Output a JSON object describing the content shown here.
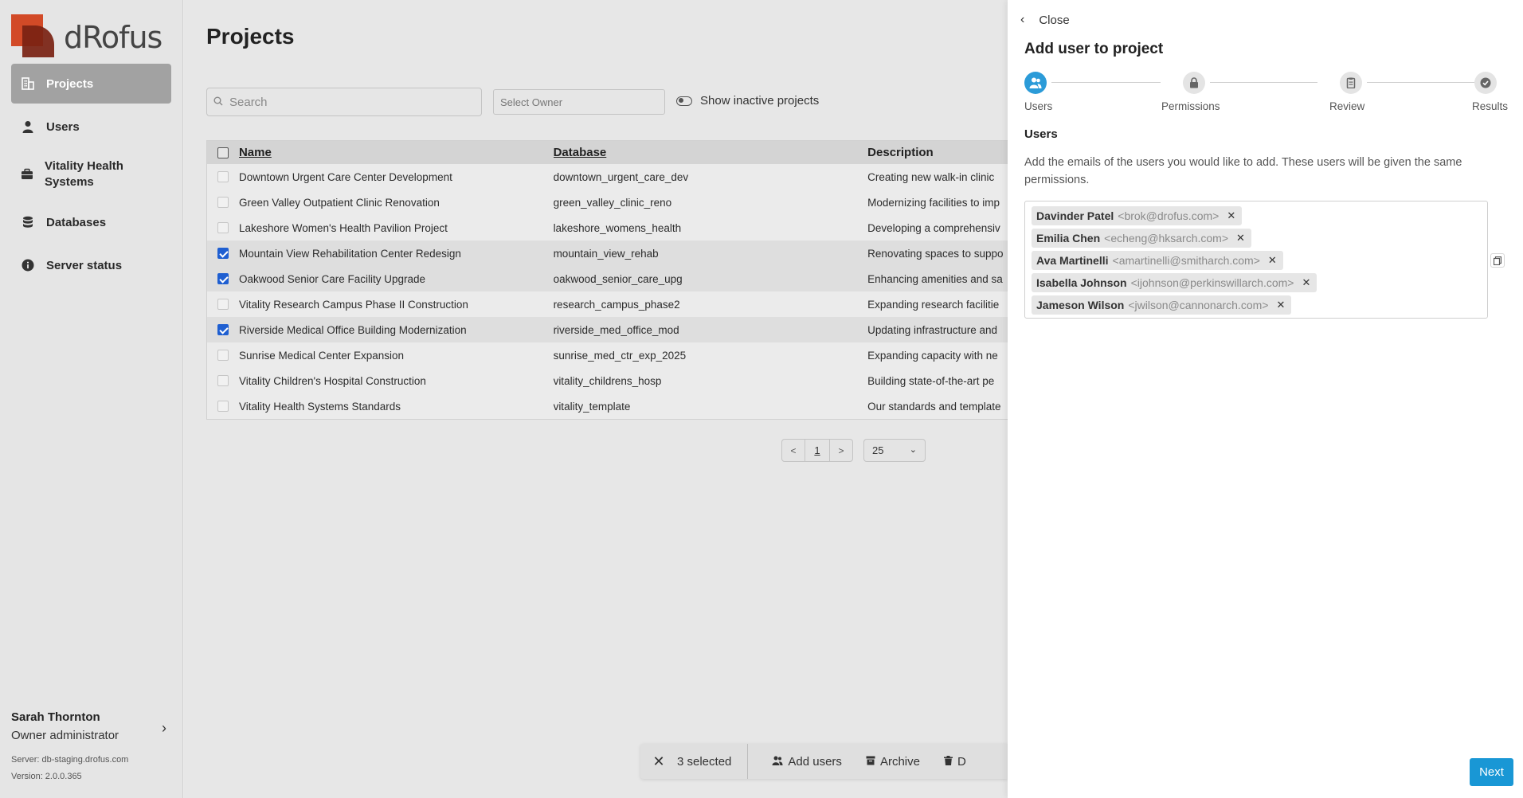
{
  "app": {
    "logo_text": "dRofus"
  },
  "sidebar": {
    "items": [
      {
        "label": "Projects",
        "icon": "building-icon"
      },
      {
        "label": "Users",
        "icon": "user-icon"
      },
      {
        "label": "Vitality Health Systems",
        "icon": "briefcase-icon"
      },
      {
        "label": "Databases",
        "icon": "database-icon"
      },
      {
        "label": "Server status",
        "icon": "info-icon"
      }
    ],
    "user": {
      "name": "Sarah Thornton",
      "role": "Owner administrator",
      "server": "Server: db-staging.drofus.com",
      "version": "Version: 2.0.0.365"
    }
  },
  "main": {
    "title": "Projects",
    "search_placeholder": "Search",
    "owner_placeholder": "Select Owner",
    "toggle_label": "Show inactive projects",
    "columns": {
      "name": "Name",
      "database": "Database",
      "description": "Description"
    },
    "rows": [
      {
        "name": "Downtown Urgent Care Center Development",
        "database": "downtown_urgent_care_dev",
        "description": "Creating new walk-in clinic",
        "selected": false
      },
      {
        "name": "Green Valley Outpatient Clinic Renovation",
        "database": "green_valley_clinic_reno",
        "description": "Modernizing facilities to imp",
        "selected": false
      },
      {
        "name": "Lakeshore Women's Health Pavilion Project",
        "database": "lakeshore_womens_health",
        "description": "Developing a comprehensiv",
        "selected": false
      },
      {
        "name": "Mountain View Rehabilitation Center Redesign",
        "database": "mountain_view_rehab",
        "description": "Renovating spaces to suppo",
        "selected": true
      },
      {
        "name": "Oakwood Senior Care Facility Upgrade",
        "database": "oakwood_senior_care_upg",
        "description": "Enhancing amenities and sa",
        "selected": true
      },
      {
        "name": "Vitality Research Campus Phase II Construction",
        "database": "research_campus_phase2",
        "description": "Expanding research facilitie",
        "selected": false
      },
      {
        "name": "Riverside Medical Office Building Modernization",
        "database": "riverside_med_office_mod",
        "description": "Updating infrastructure and",
        "selected": true
      },
      {
        "name": "Sunrise Medical Center Expansion",
        "database": "sunrise_med_ctr_exp_2025",
        "description": "Expanding capacity with ne",
        "selected": false
      },
      {
        "name": "Vitality Children's Hospital Construction",
        "database": "vitality_childrens_hosp",
        "description": "Building state-of-the-art pe",
        "selected": false
      },
      {
        "name": "Vitality Health Systems Standards",
        "database": "vitality_template",
        "description": "Our standards and template",
        "selected": false
      }
    ],
    "pager": {
      "prev": "<",
      "page": "1",
      "next": ">",
      "page_size": "25"
    },
    "actionbar": {
      "count": "3 selected",
      "add_users": "Add users",
      "archive": "Archive",
      "delete": "D"
    }
  },
  "panel": {
    "close_label": "Close",
    "title": "Add user to project",
    "steps": [
      {
        "label": "Users",
        "icon": "users-icon",
        "active": true
      },
      {
        "label": "Permissions",
        "icon": "lock-icon",
        "active": false
      },
      {
        "label": "Review",
        "icon": "clipboard-icon",
        "active": false
      },
      {
        "label": "Results",
        "icon": "check-circle-icon",
        "active": false
      }
    ],
    "section_title": "Users",
    "description": "Add the emails of the users you would like to add. These users will be given the same permissions.",
    "chips": [
      {
        "name": "Davinder Patel",
        "email": "<brok@drofus.com>"
      },
      {
        "name": "Emilia Chen",
        "email": "<echeng@hksarch.com>"
      },
      {
        "name": "Ava Martinelli",
        "email": "<amartinelli@smitharch.com>"
      },
      {
        "name": "Isabella Johnson",
        "email": "<ijohnson@perkinswillarch.com>"
      },
      {
        "name": "Jameson Wilson",
        "email": "<jwilson@cannonarch.com>"
      }
    ],
    "next_label": "Next"
  },
  "colors": {
    "accent": "#1997d5",
    "checkbox": "#1f5fd1",
    "logo_primary": "#d24a27",
    "logo_dark": "#7a2212",
    "nav_active": "#a2a2a2"
  }
}
